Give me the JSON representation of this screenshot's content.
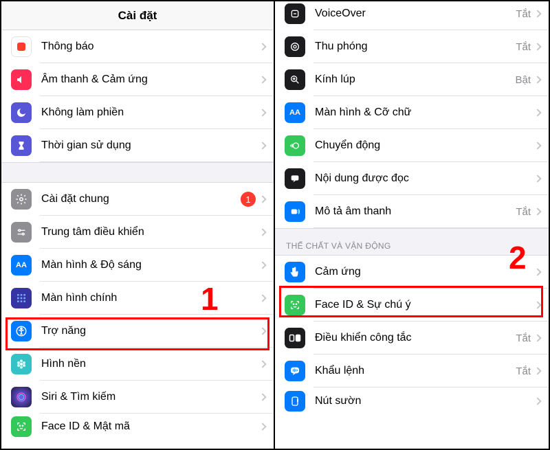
{
  "left": {
    "title": "Cài đặt",
    "group1": [
      {
        "id": "notifications",
        "icon": "bell",
        "color": "#ff3b30",
        "label": "Thông báo"
      },
      {
        "id": "sounds",
        "icon": "speaker",
        "color": "#ff2d55",
        "label": "Âm thanh & Cảm ứng"
      },
      {
        "id": "dnd",
        "icon": "moon",
        "color": "#5856d6",
        "label": "Không làm phiền"
      },
      {
        "id": "screentime",
        "icon": "hourglass",
        "color": "#5856d6",
        "label": "Thời gian sử dụng"
      }
    ],
    "group2": [
      {
        "id": "general",
        "icon": "gear",
        "color": "#8e8e93",
        "label": "Cài đặt chung",
        "badge": "1"
      },
      {
        "id": "controlcenter",
        "icon": "sliders",
        "color": "#8e8e93",
        "label": "Trung tâm điều khiển"
      },
      {
        "id": "display",
        "icon": "aa",
        "color": "#007aff",
        "label": "Màn hình & Độ sáng"
      },
      {
        "id": "homescreen",
        "icon": "grid",
        "color": "#3634a3",
        "label": "Màn hình chính"
      },
      {
        "id": "accessibility",
        "icon": "person-circle",
        "color": "#007aff",
        "label": "Trợ năng"
      },
      {
        "id": "wallpaper",
        "icon": "flower",
        "color": "#35c2c6",
        "label": "Hình nền"
      },
      {
        "id": "siri",
        "icon": "siri",
        "color": "#1c1c1e",
        "label": "Siri & Tìm kiếm"
      },
      {
        "id": "faceid",
        "icon": "face",
        "color": "#34c759",
        "label": "Face ID & Mật mã"
      }
    ],
    "annotation_number": "1"
  },
  "right": {
    "group_vision": [
      {
        "id": "voiceover",
        "icon": "vo",
        "color": "#1c1c1e",
        "label": "VoiceOver",
        "status": "Tắt"
      },
      {
        "id": "zoom",
        "icon": "zoom",
        "color": "#1c1c1e",
        "label": "Thu phóng",
        "status": "Tắt"
      },
      {
        "id": "magnifier",
        "icon": "magnifier",
        "color": "#1c1c1e",
        "label": "Kính lúp",
        "status": "Bật"
      },
      {
        "id": "textsize",
        "icon": "aa",
        "color": "#007aff",
        "label": "Màn hình & Cỡ chữ"
      },
      {
        "id": "motion",
        "icon": "motion",
        "color": "#34c759",
        "label": "Chuyển động"
      },
      {
        "id": "spoken",
        "icon": "speech",
        "color": "#1c1c1e",
        "label": "Nội dung được đọc"
      },
      {
        "id": "audiodesc",
        "icon": "ad",
        "color": "#007aff",
        "label": "Mô tả âm thanh",
        "status": "Tắt"
      }
    ],
    "section_physical": "THỂ CHẤT VÀ VẬN ĐỘNG",
    "group_physical": [
      {
        "id": "touch",
        "icon": "touch",
        "color": "#007aff",
        "label": "Cảm ứng"
      },
      {
        "id": "faceatt",
        "icon": "face",
        "color": "#34c759",
        "label": "Face ID & Sự chú ý"
      },
      {
        "id": "switch",
        "icon": "switch",
        "color": "#1c1c1e",
        "label": "Điều khiển công tắc",
        "status": "Tắt"
      },
      {
        "id": "voicectl",
        "icon": "voicectl",
        "color": "#007aff",
        "label": "Khẩu lệnh",
        "status": "Tắt"
      },
      {
        "id": "sidebutton",
        "icon": "side",
        "color": "#007aff",
        "label": "Nút sườn"
      }
    ],
    "annotation_number": "2"
  }
}
